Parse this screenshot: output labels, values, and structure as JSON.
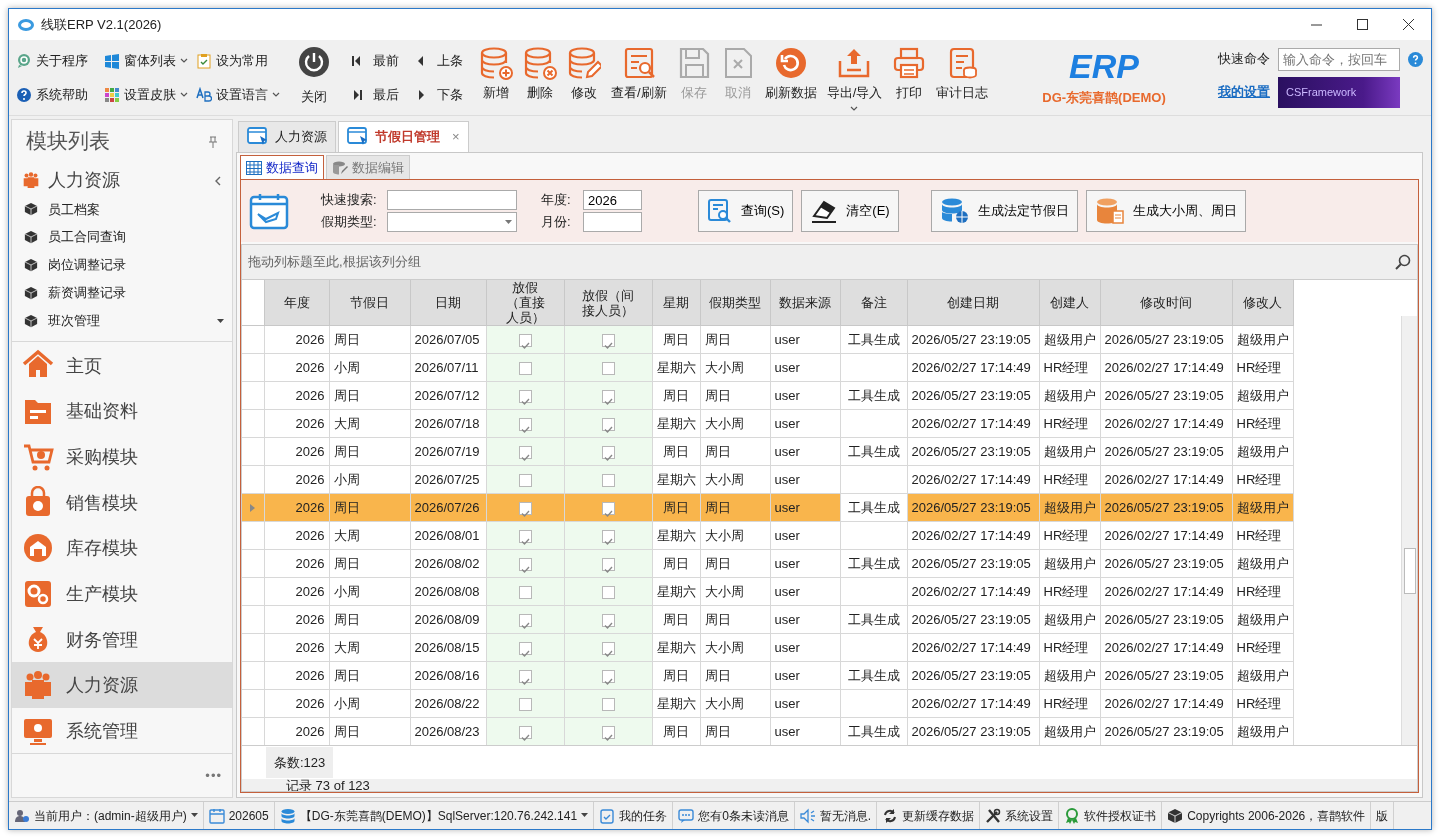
{
  "window": {
    "title": "线联ERP V2.1(2026)"
  },
  "toolbar": {
    "small_buttons": [
      {
        "label": "关于程序",
        "dropdown": false
      },
      {
        "label": "窗体列表",
        "dropdown": true
      },
      {
        "label": "设为常用",
        "dropdown": false
      },
      {
        "label": "系统帮助",
        "dropdown": false
      },
      {
        "label": "设置皮肤",
        "dropdown": true
      },
      {
        "label": "设置语言",
        "dropdown": true
      }
    ],
    "close_button": {
      "label": "关闭"
    },
    "nav_buttons": [
      {
        "label": "最前"
      },
      {
        "label": "上条"
      },
      {
        "label": "最后"
      },
      {
        "label": "下条"
      }
    ],
    "buttons": [
      {
        "label": "新增",
        "disabled": false,
        "dropdown": false
      },
      {
        "label": "删除",
        "disabled": false,
        "dropdown": false
      },
      {
        "label": "修改",
        "disabled": false,
        "dropdown": false
      },
      {
        "label": "查看/刷新",
        "disabled": false,
        "dropdown": false
      },
      {
        "label": "保存",
        "disabled": true,
        "dropdown": false
      },
      {
        "label": "取消",
        "disabled": true,
        "dropdown": false
      },
      {
        "label": "刷新数据",
        "disabled": false,
        "dropdown": false
      },
      {
        "label": "导出/导入",
        "disabled": false,
        "dropdown": true
      },
      {
        "label": "打印",
        "disabled": false,
        "dropdown": false
      },
      {
        "label": "审计日志",
        "disabled": false,
        "dropdown": false
      }
    ],
    "logo": {
      "text": "ERP",
      "subtitle": "DG-东莞喜鹊(DEMO)"
    },
    "quick_command": {
      "label": "快速命令",
      "placeholder": "输入命令，按回车"
    },
    "settings_link": "我的设置",
    "banner": "CSFramework"
  },
  "sidebar": {
    "title": "模块列表",
    "group": {
      "label": "人力资源",
      "expanded": true,
      "items": [
        {
          "label": "员工档案"
        },
        {
          "label": "员工合同查询"
        },
        {
          "label": "岗位调整记录"
        },
        {
          "label": "薪资调整记录"
        },
        {
          "label": "班次管理"
        }
      ]
    },
    "modules": [
      {
        "label": "主页",
        "selected": false
      },
      {
        "label": "基础资料",
        "selected": false
      },
      {
        "label": "采购模块",
        "selected": false
      },
      {
        "label": "销售模块",
        "selected": false
      },
      {
        "label": "库存模块",
        "selected": false
      },
      {
        "label": "生产模块",
        "selected": false
      },
      {
        "label": "财务管理",
        "selected": false
      },
      {
        "label": "人力资源",
        "selected": true
      },
      {
        "label": "系统管理",
        "selected": false
      }
    ],
    "more": "•••"
  },
  "tabs": [
    {
      "label": "人力资源",
      "selected": false
    },
    {
      "label": "节假日管理",
      "selected": true,
      "close": "×"
    }
  ],
  "subtabs": [
    {
      "label": "数据查询",
      "selected": true
    },
    {
      "label": "数据编辑",
      "selected": false
    }
  ],
  "filters": {
    "search": {
      "label": "快速搜索:"
    },
    "type": {
      "label": "假期类型:"
    },
    "year": {
      "label": "年度:",
      "value": "2026"
    },
    "month": {
      "label": "月份:"
    }
  },
  "action_buttons": [
    {
      "label": "查询(S)"
    },
    {
      "label": "清空(E)"
    },
    {
      "label": "生成法定节假日"
    },
    {
      "label": "生成大小周、周日"
    }
  ],
  "table": {
    "group_hint": "拖动列标题至此,根据该列分组",
    "columns": [
      {
        "label": "年度"
      },
      {
        "label": "节假日"
      },
      {
        "label": "日期"
      },
      {
        "label": "放假（直接人员）"
      },
      {
        "label": "放假（间接人员）"
      },
      {
        "label": "星期"
      },
      {
        "label": "假期类型"
      },
      {
        "label": "数据来源"
      },
      {
        "label": "备注"
      },
      {
        "label": "创建日期"
      },
      {
        "label": "创建人"
      },
      {
        "label": "修改时间"
      },
      {
        "label": "修改人"
      }
    ],
    "rows": [
      {
        "year": "2026",
        "holiday": "周日",
        "date": "2026/07/05",
        "off_direct": true,
        "off_indirect": true,
        "weekday": "周日",
        "type": "周日",
        "source": "user",
        "note": "工具生成",
        "created": "2026/05/27 23:19:05",
        "creator": "超级用户",
        "modified": "2026/05/27 23:19:05",
        "modifier": "超级用户",
        "selected": false
      },
      {
        "year": "2026",
        "holiday": "小周",
        "date": "2026/07/11",
        "off_direct": false,
        "off_indirect": false,
        "weekday": "星期六",
        "type": "大小周",
        "source": "user",
        "created": "2026/02/27 17:14:49",
        "creator": "HR经理",
        "modified": "2026/02/27 17:14:49",
        "modifier": "HR经理",
        "selected": false
      },
      {
        "year": "2026",
        "holiday": "周日",
        "date": "2026/07/12",
        "off_direct": true,
        "off_indirect": true,
        "weekday": "周日",
        "type": "周日",
        "source": "user",
        "note": "工具生成",
        "created": "2026/05/27 23:19:05",
        "creator": "超级用户",
        "modified": "2026/05/27 23:19:05",
        "modifier": "超级用户",
        "selected": false
      },
      {
        "year": "2026",
        "holiday": "大周",
        "date": "2026/07/18",
        "off_direct": true,
        "off_indirect": true,
        "weekday": "星期六",
        "type": "大小周",
        "source": "user",
        "created": "2026/02/27 17:14:49",
        "creator": "HR经理",
        "modified": "2026/02/27 17:14:49",
        "modifier": "HR经理",
        "selected": false
      },
      {
        "year": "2026",
        "holiday": "周日",
        "date": "2026/07/19",
        "off_direct": true,
        "off_indirect": true,
        "weekday": "周日",
        "type": "周日",
        "source": "user",
        "note": "工具生成",
        "created": "2026/05/27 23:19:05",
        "creator": "超级用户",
        "modified": "2026/05/27 23:19:05",
        "modifier": "超级用户",
        "selected": false
      },
      {
        "year": "2026",
        "holiday": "小周",
        "date": "2026/07/25",
        "off_direct": false,
        "off_indirect": false,
        "weekday": "星期六",
        "type": "大小周",
        "source": "user",
        "created": "2026/02/27 17:14:49",
        "creator": "HR经理",
        "modified": "2026/02/27 17:14:49",
        "modifier": "HR经理",
        "selected": false
      },
      {
        "year": "2026",
        "holiday": "周日",
        "date": "2026/07/26",
        "off_direct": true,
        "off_indirect": true,
        "weekday": "周日",
        "type": "周日",
        "source": "user",
        "note": "工具生成",
        "created": "2026/05/27 23:19:05",
        "creator": "超级用户",
        "modified": "2026/05/27 23:19:05",
        "modifier": "超级用户",
        "selected": true
      },
      {
        "year": "2026",
        "holiday": "大周",
        "date": "2026/08/01",
        "off_direct": true,
        "off_indirect": true,
        "weekday": "星期六",
        "type": "大小周",
        "source": "user",
        "created": "2026/02/27 17:14:49",
        "creator": "HR经理",
        "modified": "2026/02/27 17:14:49",
        "modifier": "HR经理",
        "selected": false
      },
      {
        "year": "2026",
        "holiday": "周日",
        "date": "2026/08/02",
        "off_direct": true,
        "off_indirect": true,
        "weekday": "周日",
        "type": "周日",
        "source": "user",
        "note": "工具生成",
        "created": "2026/05/27 23:19:05",
        "creator": "超级用户",
        "modified": "2026/05/27 23:19:05",
        "modifier": "超级用户",
        "selected": false
      },
      {
        "year": "2026",
        "holiday": "小周",
        "date": "2026/08/08",
        "off_direct": false,
        "off_indirect": false,
        "weekday": "星期六",
        "type": "大小周",
        "source": "user",
        "created": "2026/02/27 17:14:49",
        "creator": "HR经理",
        "modified": "2026/02/27 17:14:49",
        "modifier": "HR经理",
        "selected": false
      },
      {
        "year": "2026",
        "holiday": "周日",
        "date": "2026/08/09",
        "off_direct": true,
        "off_indirect": true,
        "weekday": "周日",
        "type": "周日",
        "source": "user",
        "note": "工具生成",
        "created": "2026/05/27 23:19:05",
        "creator": "超级用户",
        "modified": "2026/05/27 23:19:05",
        "modifier": "超级用户",
        "selected": false
      },
      {
        "year": "2026",
        "holiday": "大周",
        "date": "2026/08/15",
        "off_direct": true,
        "off_indirect": true,
        "weekday": "星期六",
        "type": "大小周",
        "source": "user",
        "created": "2026/02/27 17:14:49",
        "creator": "HR经理",
        "modified": "2026/02/27 17:14:49",
        "modifier": "HR经理",
        "selected": false
      },
      {
        "year": "2026",
        "holiday": "周日",
        "date": "2026/08/16",
        "off_direct": true,
        "off_indirect": true,
        "weekday": "周日",
        "type": "周日",
        "source": "user",
        "note": "工具生成",
        "created": "2026/05/27 23:19:05",
        "creator": "超级用户",
        "modified": "2026/05/27 23:19:05",
        "modifier": "超级用户",
        "selected": false
      },
      {
        "year": "2026",
        "holiday": "小周",
        "date": "2026/08/22",
        "off_direct": false,
        "off_indirect": false,
        "weekday": "星期六",
        "type": "大小周",
        "source": "user",
        "created": "2026/02/27 17:14:49",
        "creator": "HR经理",
        "modified": "2026/02/27 17:14:49",
        "modifier": "HR经理",
        "selected": false
      },
      {
        "year": "2026",
        "holiday": "周日",
        "date": "2026/08/23",
        "off_direct": true,
        "off_indirect": true,
        "weekday": "周日",
        "type": "周日",
        "source": "user",
        "note": "工具生成",
        "created": "2026/05/27 23:19:05",
        "creator": "超级用户",
        "modified": "2026/05/27 23:19:05",
        "modifier": "超级用户",
        "selected": false
      }
    ],
    "count": "条数:123",
    "navigator": "记录 73 of 123"
  },
  "status_bar": [
    {
      "text": "当前用户：(admin-超级用户)",
      "dropdown": true
    },
    {
      "text": "202605",
      "dropdown": false
    },
    {
      "text": "【DG-东莞喜鹊(DEMO)】SqlServer:120.76.242.141",
      "dropdown": true
    },
    {
      "text": "我的任务",
      "dropdown": false
    },
    {
      "text": "您有0条未读消息",
      "dropdown": false
    },
    {
      "text": "暂无消息.",
      "dropdown": false
    },
    {
      "text": "更新缓存数据",
      "dropdown": false
    },
    {
      "text": "系统设置",
      "dropdown": false
    },
    {
      "text": "软件授权证书",
      "dropdown": false
    },
    {
      "text": "Copyrights 2006-2026，喜鹊软件",
      "dropdown": false
    },
    {
      "text": "版",
      "dropdown": false
    }
  ]
}
